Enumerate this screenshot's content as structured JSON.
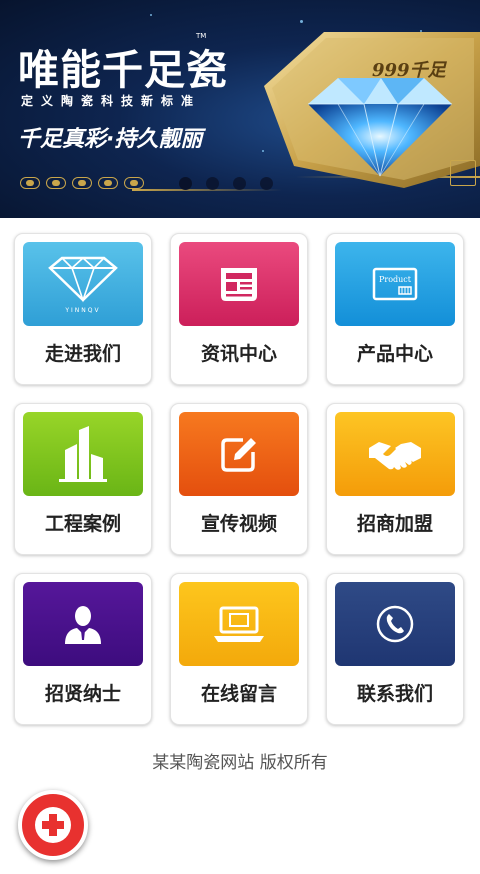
{
  "banner": {
    "brand": "唯能千足瓷",
    "trademark": "TM",
    "subtitle": "定义陶瓷科技新标准",
    "slogan": "千足真彩·持久靓丽",
    "product_mark": "999千足",
    "slides": 4,
    "active_slide": 1,
    "colors": {
      "background": "#0e2550",
      "gold": "#c9a64b"
    }
  },
  "menu": [
    {
      "label": "走进我们",
      "icon": "diamond-icon",
      "color_top": "#59c2ea",
      "color_bottom": "#2f9fd6",
      "icon_text": "YINNQV"
    },
    {
      "label": "资讯中心",
      "icon": "newspaper-icon",
      "color_top": "#ea4a7e",
      "color_bottom": "#cc1f5a"
    },
    {
      "label": "产品中心",
      "icon": "product-box-icon",
      "color_top": "#3db5ec",
      "color_bottom": "#138fd8",
      "icon_text": "Product"
    },
    {
      "label": "工程案例",
      "icon": "buildings-icon",
      "color_top": "#98d528",
      "color_bottom": "#6ab516"
    },
    {
      "label": "宣传视频",
      "icon": "edit-icon",
      "color_top": "#f7791f",
      "color_bottom": "#e44f0e"
    },
    {
      "label": "招商加盟",
      "icon": "handshake-icon",
      "color_top": "#fdc524",
      "color_bottom": "#f49c09"
    },
    {
      "label": "招贤纳士",
      "icon": "person-icon",
      "color_top": "#56179a",
      "color_bottom": "#3d0c7e"
    },
    {
      "label": "在线留言",
      "icon": "laptop-icon",
      "color_top": "#fdc61d",
      "color_bottom": "#f3a90b"
    },
    {
      "label": "联系我们",
      "icon": "phone-icon",
      "color_top": "#2f4a86",
      "color_bottom": "#1f3672"
    }
  ],
  "footer": {
    "copyright": "某某陶瓷网站 版权所有"
  },
  "fab": {
    "icon": "plus-icon",
    "color": "#e8312f"
  }
}
